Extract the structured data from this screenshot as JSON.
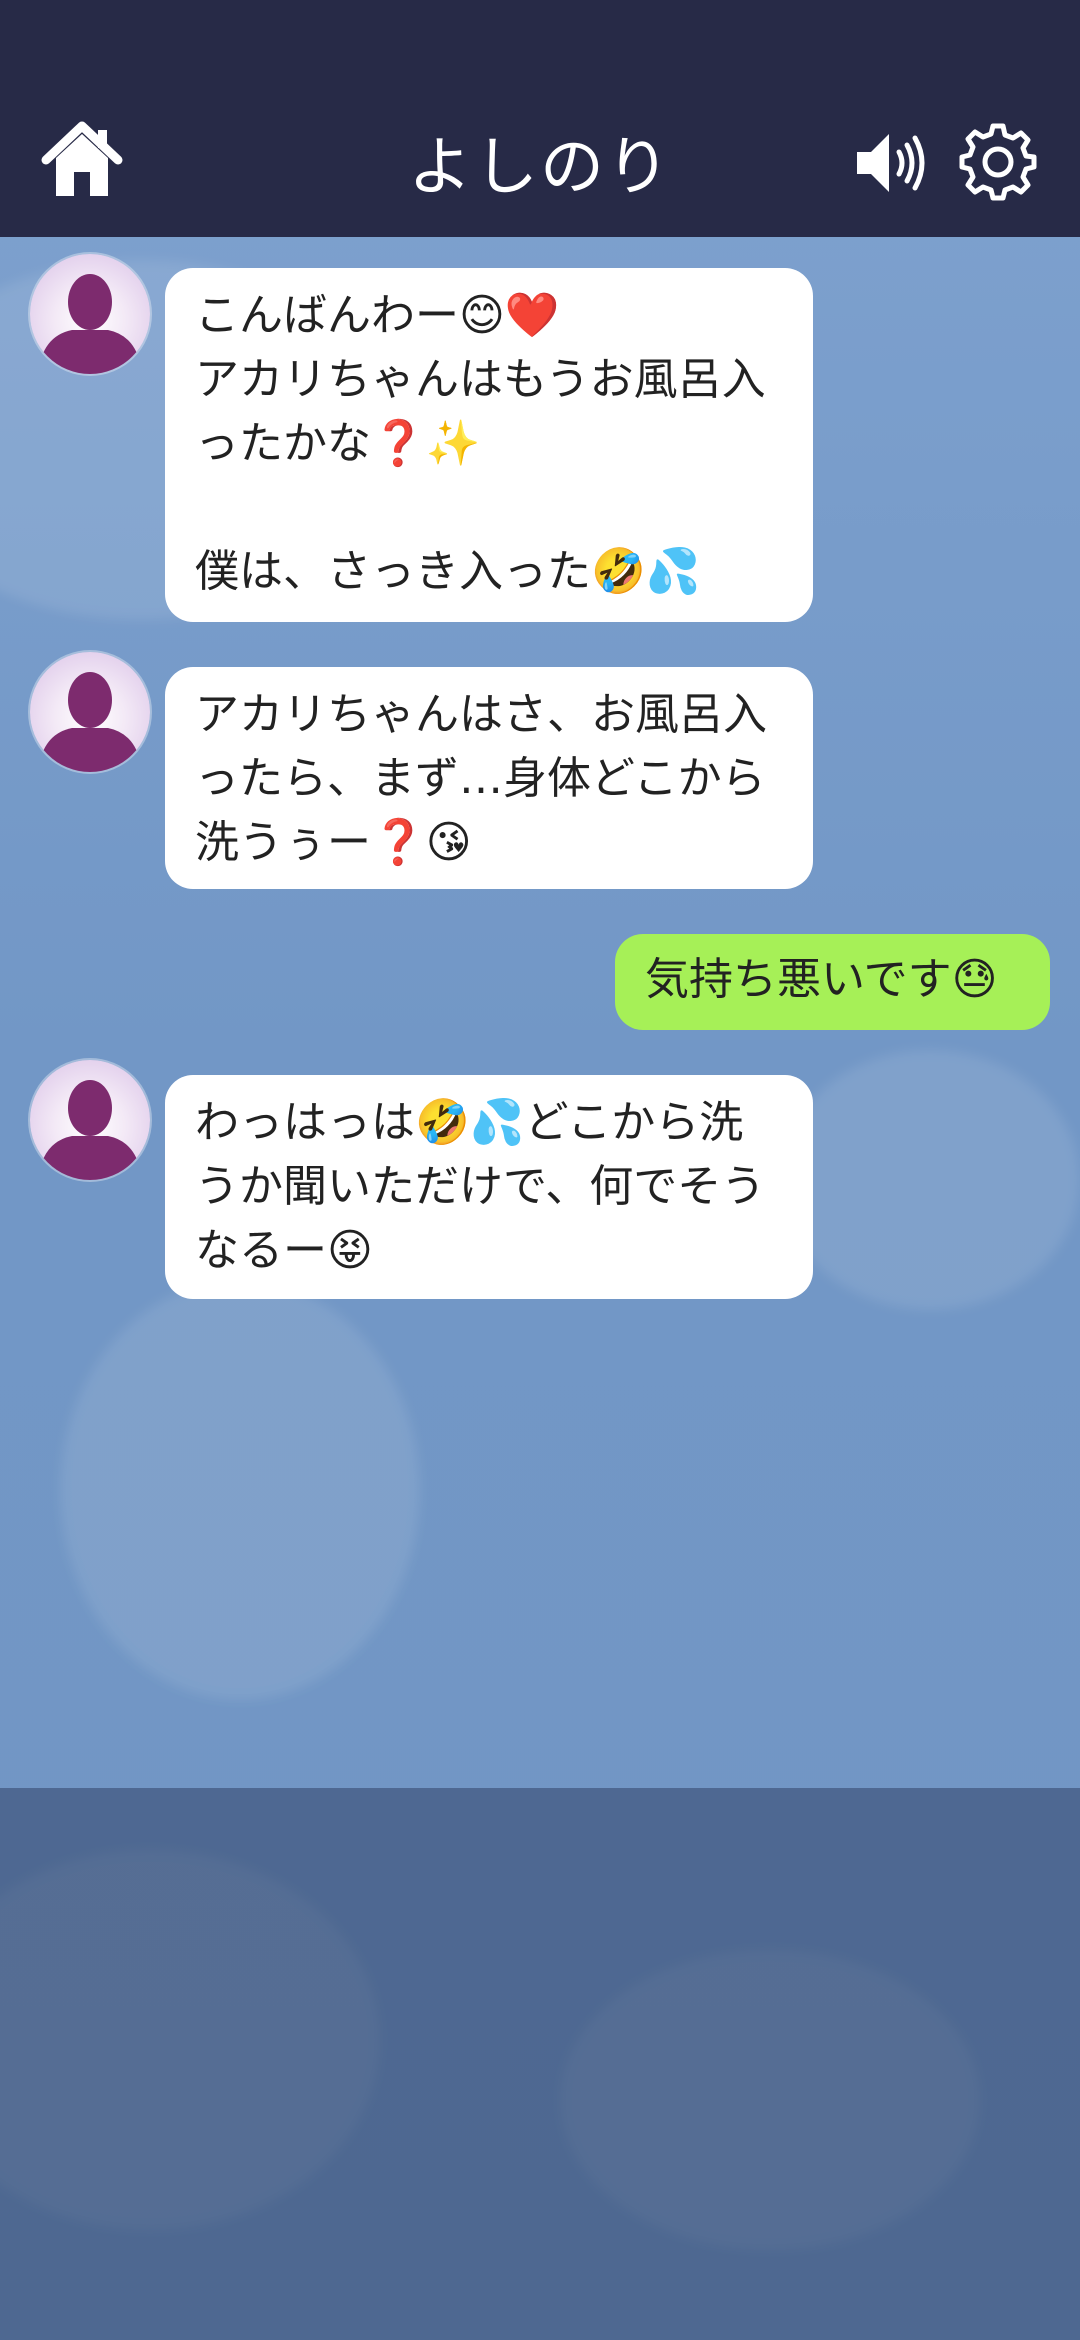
{
  "header": {
    "title": "よしのり",
    "home_icon": "home-icon",
    "sound_icon": "speaker-icon",
    "settings_icon": "gear-icon"
  },
  "messages": [
    {
      "sender": "contact",
      "text": "こんばんわー😊❤️\nアカリちゃんはもうお風呂入ったかな❓✨\n\n僕は、さっき入った🤣💦"
    },
    {
      "sender": "contact",
      "text": "アカリちゃんはさ、お風呂入ったら、まず…身体どこから洗うぅー❓😘"
    },
    {
      "sender": "me",
      "text": "気持ち悪いです😓"
    },
    {
      "sender": "contact",
      "text": "わっはっは🤣💦どこから洗うか聞いただけで、何でそうなるー😝"
    }
  ],
  "colors": {
    "header_bg": "#272a47",
    "incoming_bubble": "#ffffff",
    "outgoing_bubble": "#a6f057",
    "avatar_silhouette": "#7d2b6e"
  }
}
